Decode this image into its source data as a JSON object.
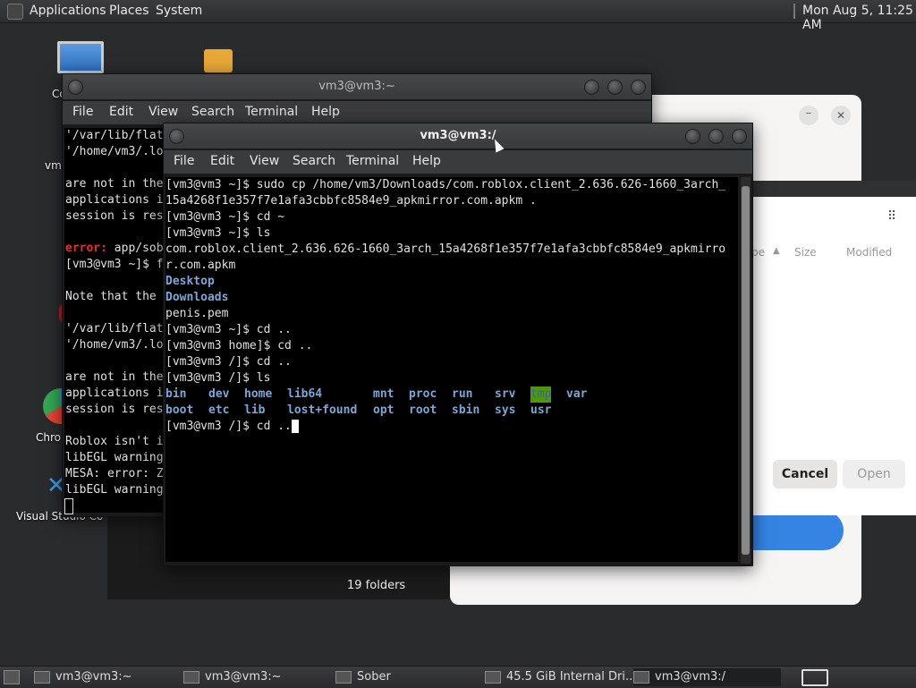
{
  "top_panel": {
    "menus": [
      "Applications",
      "Places",
      "System"
    ],
    "clock": "Mon Aug  5, 11:25 AM"
  },
  "desktop": {
    "icons": [
      {
        "label": "Co",
        "icon": "computer-icon"
      },
      {
        "label": "vm",
        "icon": "home-folder-icon"
      },
      {
        "label": "Chro",
        "icon": "chrome-icon"
      },
      {
        "label": "Visual Studio Co",
        "icon": "vscode-icon"
      }
    ]
  },
  "back_terminal": {
    "title": "vm3@vm3:~",
    "menu": [
      "File",
      "Edit",
      "View",
      "Search",
      "Terminal",
      "Help"
    ],
    "lines": [
      "'/var/lib/flat",
      "'/home/vm3/.lo",
      "",
      "are not in the",
      "applications i",
      "session is res",
      "",
      "error: app/sob",
      "[vm3@vm3 ~]$ f",
      "",
      "Note that the",
      "",
      "'/var/lib/flat",
      "'/home/vm3/.lo",
      "",
      "are not in the",
      "applications i",
      "session is res",
      "",
      "Roblox isn't i",
      "libEGL warning",
      "MESA: error: Z",
      "libEGL warning"
    ]
  },
  "front_terminal": {
    "title": "vm3@vm3:/",
    "menu": [
      "File",
      "Edit",
      "View",
      "Search",
      "Terminal",
      "Help"
    ],
    "lines": [
      "[vm3@vm3 ~]$ sudo cp /home/vm3/Downloads/com.roblox.client_2.636.626-1660_3arch_",
      "15a4268f1e357f7e1afa3cbbfc8584e9_apkmirror.com.apkm .",
      "[vm3@vm3 ~]$ cd ~",
      "[vm3@vm3 ~]$ ls",
      "com.roblox.client_2.636.626-1660_3arch_15a4268f1e357f7e1afa3cbbfc8584e9_apkmirro",
      "r.com.apkm",
      "Desktop",
      "Downloads",
      "penis.pem",
      "[vm3@vm3 ~]$ cd ..",
      "[vm3@vm3 home]$ cd ..",
      "[vm3@vm3 /]$ cd ..",
      "[vm3@vm3 /]$ ls"
    ],
    "ls_row1": [
      "bin",
      "dev",
      "home",
      "lib64",
      "mnt",
      "proc",
      "run",
      "srv",
      "tmp",
      "var"
    ],
    "ls_row2": [
      "boot",
      "etc",
      "lib",
      "lost+found",
      "opt",
      "root",
      "sbin",
      "sys",
      "usr"
    ],
    "prompt_line": "[vm3@vm3 /]$ cd .."
  },
  "file_dialog": {
    "columns": {
      "type": "pe",
      "size": "Size",
      "modified": "Modified"
    },
    "cancel_label": "Cancel",
    "open_label": "Open"
  },
  "file_manager": {
    "status": "19 folders"
  },
  "taskbar": {
    "items": [
      "vm3@vm3:~",
      "vm3@vm3:~",
      "Sober",
      "45.5 GiB Internal Dri...",
      "vm3@vm3:/"
    ]
  }
}
